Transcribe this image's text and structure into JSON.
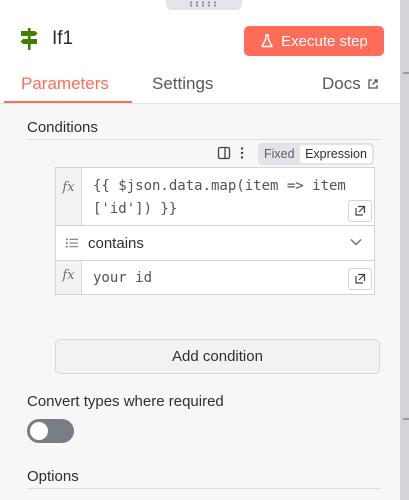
{
  "node": {
    "title": "If1",
    "icon": "if-signpost-icon",
    "icon_color": "#408000"
  },
  "header": {
    "execute_label": "Execute step",
    "execute_icon": "flask-icon",
    "accent": "#ff6d5a"
  },
  "tabs": [
    {
      "label": "Parameters",
      "active": true
    },
    {
      "label": "Settings",
      "active": false
    },
    {
      "label": "Docs",
      "active": false,
      "icon": "external-link-icon"
    }
  ],
  "conditions": {
    "label": "Conditions",
    "mode_options": [
      "Fixed",
      "Expression"
    ],
    "mode_selected": "Expression",
    "left_value_line1": "{{ $json.data.map(item => item",
    "left_value_line2": "['id']) }}",
    "operator": "contains",
    "right_value": "your id",
    "fx_label": "fx"
  },
  "add_condition_label": "Add condition",
  "convert_types": {
    "label": "Convert types where required",
    "enabled": false
  },
  "options_label": "Options"
}
